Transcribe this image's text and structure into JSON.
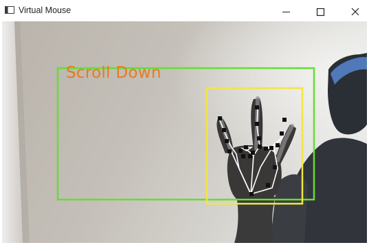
{
  "window": {
    "title": "Virtual Mouse",
    "icon": "app-window-icon",
    "controls": [
      "minimize-icon",
      "maximize-icon",
      "close-icon"
    ]
  },
  "camera_view": {
    "gesture_label": "Scroll Down",
    "colors": {
      "gesture_label": "#e97a1c",
      "active_region_frame": "#66dd33",
      "hand_bounding_box": "#f2e640",
      "landmark_point": "#111111",
      "landmark_connection": "#ffffff"
    }
  }
}
